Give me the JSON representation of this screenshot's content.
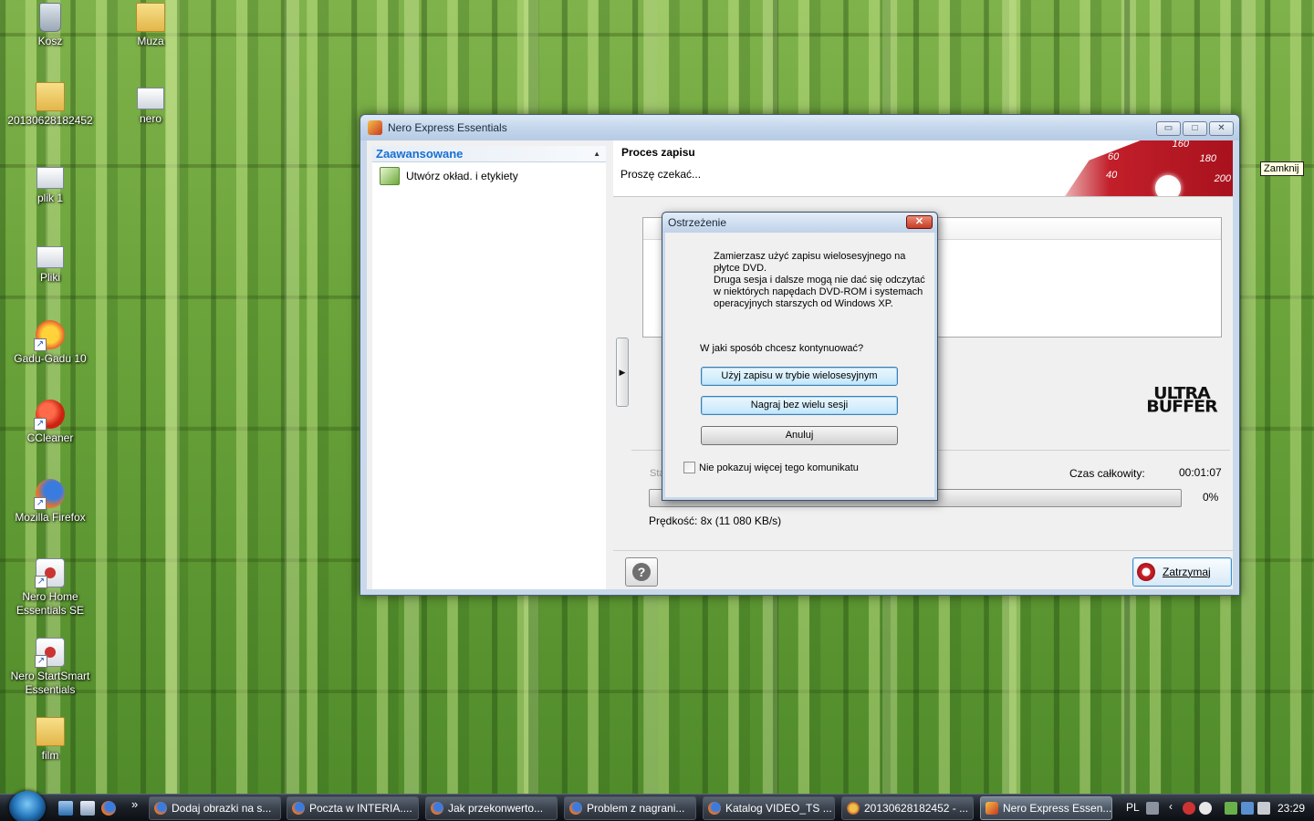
{
  "desktop": {
    "icons": [
      {
        "label": "Kosz"
      },
      {
        "label": "Muza"
      },
      {
        "label": "20130628182452"
      },
      {
        "label": "nero"
      },
      {
        "label": "plik 1"
      },
      {
        "label": "Pliki"
      },
      {
        "label": "Gadu-Gadu 10"
      },
      {
        "label": "CCleaner"
      },
      {
        "label": "Mozilla Firefox"
      },
      {
        "label": "Nero Home Essentials SE"
      },
      {
        "label": "Nero StartSmart Essentials"
      },
      {
        "label": "film"
      }
    ]
  },
  "window": {
    "title": "Nero Express Essentials",
    "controls": {
      "minimize": "▭",
      "maximize": "□",
      "close": "✕"
    },
    "left_pane": {
      "section_title": "Zaawansowane",
      "items": [
        {
          "label": "Utwórz okład. i etykiety"
        }
      ]
    },
    "header": {
      "title": "Proces zapisu",
      "subtitle": "Proszę czekać...",
      "gauge_numbers": [
        "160",
        "180",
        "60",
        "40",
        "200"
      ]
    },
    "logo_text": {
      "line1": "ULTRA",
      "line2": "BUFFER"
    },
    "status_prefix": "Sta",
    "total_time_label": "Czas całkowity:",
    "total_time_value": "00:01:07",
    "progress_percent": 0,
    "progress_text": "0%",
    "speed": "Prędkość: 8x (11 080 KB/s)",
    "stop_button": "Zatrzymaj",
    "close_tooltip": "Zamknij"
  },
  "dialog": {
    "title": "Ostrzeżenie",
    "message_lines": [
      "Zamierzasz użyć zapisu wielosesyjnego na",
      "płytce DVD.",
      "Druga sesja i dalsze mogą nie dać się odczytać",
      "w niektórych napędach DVD-ROM i systemach",
      "operacyjnych starszych od Windows XP."
    ],
    "question": "W jaki sposób chcesz kontynuować?",
    "buttons": {
      "multisession": "Użyj zapisu w trybie wielosesyjnym",
      "single": "Nagraj bez wielu sesji",
      "cancel": "Anuluj"
    },
    "checkbox_label": "Nie pokazuj więcej tego komunikatu",
    "checkbox_checked": false
  },
  "taskbar": {
    "tasks": [
      {
        "label": "Dodaj obrazki na s..."
      },
      {
        "label": "Poczta w INTERIA...."
      },
      {
        "label": "Jak przekonwerto..."
      },
      {
        "label": "Problem z nagrani..."
      },
      {
        "label": "Katalog VIDEO_TS ..."
      },
      {
        "label": "20130628182452 - ..."
      },
      {
        "label": "Nero Express Essen..."
      }
    ],
    "overflow_chevron": "»",
    "language": "PL",
    "clock": "23:29"
  }
}
